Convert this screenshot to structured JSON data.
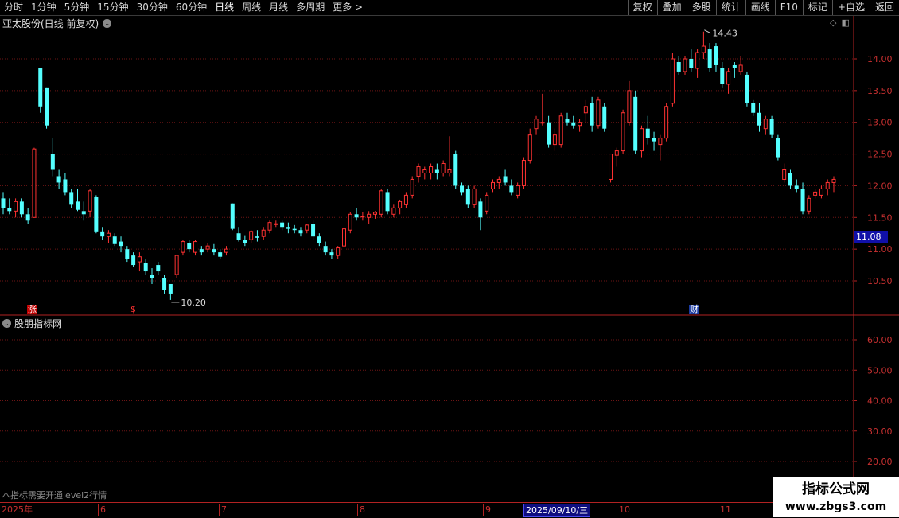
{
  "toolbar": {
    "left": [
      "分时",
      "1分钟",
      "5分钟",
      "15分钟",
      "30分钟",
      "60分钟",
      "日线",
      "周线",
      "月线",
      "多周期",
      "更多 >"
    ],
    "active": "日线",
    "right": [
      "复权",
      "叠加",
      "多股",
      "统计",
      "画线",
      "F10",
      "标记",
      "+自选",
      "返回"
    ]
  },
  "stock": {
    "title": "亚太股份(日线 前复权)"
  },
  "indicator": {
    "name": "股朋指标网",
    "notice": "本指标需要开通level2行情"
  },
  "price_axis": {
    "labels": [
      "14.00",
      "13.50",
      "13.00",
      "12.50",
      "12.00",
      "11.50",
      "11.00",
      "10.50"
    ],
    "current": "11.08"
  },
  "indicator_axis": {
    "labels": [
      "60.00",
      "50.00",
      "40.00",
      "30.00",
      "20.00"
    ]
  },
  "annotations": {
    "high": "14.43",
    "low": "10.20",
    "marker_zhang": "涨",
    "marker_s": "$",
    "marker_cai": "财"
  },
  "date_axis": {
    "labels": [
      "2025年",
      "6",
      "7",
      "8",
      "9",
      "10",
      "11"
    ],
    "cursor": "2025/09/10/三"
  },
  "watermark": {
    "line1": "指标公式网",
    "line2": "www.zbgs3.com"
  },
  "colors": {
    "up": "#ff3232",
    "down": "#54ffff",
    "grid": "#7a1010",
    "axis": "#b22222",
    "bg": "#000000"
  },
  "chart_data": {
    "type": "candlestick",
    "y_range": [
      10.1,
      14.55
    ],
    "candles": [
      [
        11.8,
        11.9,
        11.55,
        11.65
      ],
      [
        11.65,
        11.8,
        11.55,
        11.6
      ],
      [
        11.6,
        11.8,
        11.5,
        11.75
      ],
      [
        11.75,
        11.8,
        11.5,
        11.55
      ],
      [
        11.55,
        11.65,
        11.4,
        11.45
      ],
      [
        11.5,
        12.6,
        11.5,
        12.58
      ],
      [
        13.85,
        13.85,
        13.15,
        13.25
      ],
      [
        13.55,
        13.55,
        12.9,
        12.95
      ],
      [
        12.5,
        12.75,
        12.15,
        12.25
      ],
      [
        12.15,
        12.25,
        11.95,
        12.05
      ],
      [
        12.1,
        12.2,
        11.85,
        11.9
      ],
      [
        11.9,
        11.95,
        11.65,
        11.7
      ],
      [
        11.75,
        11.95,
        11.6,
        11.62
      ],
      [
        11.6,
        11.75,
        11.45,
        11.55
      ],
      [
        11.6,
        11.95,
        11.5,
        11.92
      ],
      [
        11.82,
        11.85,
        11.25,
        11.28
      ],
      [
        11.28,
        11.35,
        11.15,
        11.2
      ],
      [
        11.2,
        11.3,
        11.1,
        11.25
      ],
      [
        11.2,
        11.25,
        11.05,
        11.08
      ],
      [
        11.12,
        11.2,
        10.95,
        11.05
      ],
      [
        11.0,
        11.05,
        10.8,
        10.85
      ],
      [
        10.9,
        10.95,
        10.72,
        10.75
      ],
      [
        10.8,
        10.95,
        10.65,
        10.88
      ],
      [
        10.78,
        10.85,
        10.6,
        10.65
      ],
      [
        10.6,
        10.7,
        10.45,
        10.55
      ],
      [
        10.75,
        10.8,
        10.6,
        10.65
      ],
      [
        10.55,
        10.6,
        10.3,
        10.35
      ],
      [
        10.45,
        10.4,
        10.2,
        10.3
      ],
      [
        10.6,
        10.9,
        10.55,
        10.9
      ],
      [
        10.95,
        11.15,
        10.9,
        11.12
      ],
      [
        11.1,
        11.15,
        10.95,
        11.0
      ],
      [
        10.95,
        11.15,
        10.9,
        11.12
      ],
      [
        11.0,
        11.05,
        10.9,
        10.95
      ],
      [
        11.0,
        11.1,
        10.95,
        11.05
      ],
      [
        11.0,
        11.08,
        10.9,
        10.95
      ],
      [
        10.95,
        11.0,
        10.85,
        10.88
      ],
      [
        10.95,
        11.05,
        10.9,
        11.0
      ],
      [
        11.72,
        11.72,
        11.3,
        11.32
      ],
      [
        11.25,
        11.35,
        11.12,
        11.15
      ],
      [
        11.15,
        11.22,
        11.05,
        11.1
      ],
      [
        11.15,
        11.3,
        11.1,
        11.28
      ],
      [
        11.2,
        11.3,
        11.12,
        11.18
      ],
      [
        11.2,
        11.35,
        11.15,
        11.3
      ],
      [
        11.3,
        11.45,
        11.25,
        11.42
      ],
      [
        11.4,
        11.45,
        11.35,
        11.4
      ],
      [
        11.42,
        11.45,
        11.3,
        11.35
      ],
      [
        11.35,
        11.42,
        11.25,
        11.32
      ],
      [
        11.32,
        11.38,
        11.25,
        11.3
      ],
      [
        11.3,
        11.35,
        11.2,
        11.25
      ],
      [
        11.3,
        11.4,
        11.25,
        11.38
      ],
      [
        11.4,
        11.45,
        11.15,
        11.2
      ],
      [
        11.2,
        11.25,
        11.05,
        11.1
      ],
      [
        11.05,
        11.12,
        10.9,
        10.95
      ],
      [
        10.95,
        11.0,
        10.85,
        10.9
      ],
      [
        10.9,
        11.05,
        10.85,
        11.02
      ],
      [
        11.05,
        11.35,
        11.0,
        11.32
      ],
      [
        11.3,
        11.58,
        11.25,
        11.55
      ],
      [
        11.55,
        11.65,
        11.45,
        11.5
      ],
      [
        11.52,
        11.58,
        11.45,
        11.52
      ],
      [
        11.5,
        11.6,
        11.4,
        11.55
      ],
      [
        11.55,
        11.6,
        11.48,
        11.58
      ],
      [
        11.55,
        11.95,
        11.5,
        11.92
      ],
      [
        11.9,
        11.95,
        11.55,
        11.6
      ],
      [
        11.55,
        11.7,
        11.5,
        11.65
      ],
      [
        11.65,
        11.78,
        11.55,
        11.75
      ],
      [
        11.7,
        11.9,
        11.65,
        11.85
      ],
      [
        11.85,
        12.15,
        11.8,
        12.1
      ],
      [
        12.15,
        12.35,
        12.05,
        12.3
      ],
      [
        12.2,
        12.3,
        12.1,
        12.25
      ],
      [
        12.2,
        12.35,
        12.1,
        12.3
      ],
      [
        12.25,
        12.35,
        12.1,
        12.2
      ],
      [
        12.2,
        12.4,
        12.15,
        12.35
      ],
      [
        12.2,
        12.78,
        12.15,
        12.25
      ],
      [
        12.5,
        12.55,
        11.95,
        12.0
      ],
      [
        12.0,
        12.05,
        11.85,
        11.9
      ],
      [
        11.95,
        12.0,
        11.65,
        11.7
      ],
      [
        11.7,
        12.0,
        11.65,
        11.95
      ],
      [
        11.75,
        11.8,
        11.3,
        11.5
      ],
      [
        11.6,
        11.9,
        11.55,
        11.85
      ],
      [
        11.95,
        12.1,
        11.9,
        12.05
      ],
      [
        12.05,
        12.15,
        11.95,
        12.1
      ],
      [
        12.15,
        12.25,
        12.0,
        12.05
      ],
      [
        12.0,
        12.1,
        11.85,
        11.9
      ],
      [
        11.85,
        12.05,
        11.8,
        12.0
      ],
      [
        12.0,
        12.45,
        11.95,
        12.4
      ],
      [
        12.4,
        12.9,
        12.35,
        12.8
      ],
      [
        12.9,
        13.1,
        12.8,
        13.05
      ],
      [
        13.0,
        13.45,
        12.95,
        13.0
      ],
      [
        13.0,
        13.1,
        12.6,
        12.65
      ],
      [
        12.65,
        12.9,
        12.55,
        12.8
      ],
      [
        12.65,
        13.15,
        12.6,
        13.1
      ],
      [
        13.05,
        13.15,
        12.95,
        13.0
      ],
      [
        13.0,
        13.1,
        12.9,
        12.95
      ],
      [
        12.95,
        13.05,
        12.85,
        13.0
      ],
      [
        13.15,
        13.35,
        13.0,
        13.25
      ],
      [
        13.3,
        13.4,
        12.85,
        12.95
      ],
      [
        12.95,
        13.4,
        12.9,
        13.35
      ],
      [
        13.25,
        13.3,
        12.85,
        12.9
      ],
      [
        12.1,
        12.5,
        12.05,
        12.5
      ],
      [
        12.48,
        12.6,
        12.3,
        12.55
      ],
      [
        12.55,
        13.2,
        12.5,
        13.15
      ],
      [
        13.0,
        13.65,
        12.95,
        13.5
      ],
      [
        13.4,
        13.5,
        12.5,
        12.55
      ],
      [
        12.55,
        12.95,
        12.45,
        12.9
      ],
      [
        12.9,
        13.1,
        12.65,
        12.75
      ],
      [
        12.75,
        12.85,
        12.55,
        12.7
      ],
      [
        12.65,
        12.8,
        12.4,
        12.75
      ],
      [
        12.75,
        13.3,
        12.7,
        13.25
      ],
      [
        13.3,
        14.1,
        13.25,
        14.0
      ],
      [
        13.95,
        14.05,
        13.75,
        13.8
      ],
      [
        13.8,
        14.05,
        13.75,
        14.0
      ],
      [
        14.0,
        14.15,
        13.8,
        13.85
      ],
      [
        13.85,
        14.15,
        13.7,
        14.1
      ],
      [
        14.1,
        14.43,
        14.0,
        14.2
      ],
      [
        14.15,
        14.25,
        13.8,
        13.85
      ],
      [
        14.2,
        14.25,
        13.8,
        13.9
      ],
      [
        13.85,
        13.95,
        13.55,
        13.6
      ],
      [
        13.6,
        13.85,
        13.45,
        13.8
      ],
      [
        13.9,
        13.95,
        13.7,
        13.85
      ],
      [
        13.8,
        14.05,
        13.75,
        13.9
      ],
      [
        13.75,
        13.8,
        13.25,
        13.3
      ],
      [
        13.3,
        13.35,
        13.1,
        13.15
      ],
      [
        13.15,
        13.3,
        12.85,
        12.95
      ],
      [
        12.9,
        13.1,
        12.8,
        13.05
      ],
      [
        13.05,
        13.1,
        12.75,
        12.8
      ],
      [
        12.75,
        12.8,
        12.4,
        12.45
      ],
      [
        12.1,
        12.35,
        12.05,
        12.25
      ],
      [
        12.2,
        12.25,
        11.95,
        12.0
      ],
      [
        12.0,
        12.1,
        11.9,
        11.95
      ],
      [
        11.95,
        12.05,
        11.55,
        11.6
      ],
      [
        11.6,
        11.85,
        11.55,
        11.8
      ],
      [
        11.85,
        11.95,
        11.8,
        11.9
      ],
      [
        11.85,
        12.0,
        11.8,
        11.95
      ],
      [
        11.95,
        12.1,
        11.85,
        12.05
      ],
      [
        12.05,
        12.15,
        11.9,
        12.1
      ]
    ],
    "high_label": "14.43",
    "low_label": "10.20"
  }
}
